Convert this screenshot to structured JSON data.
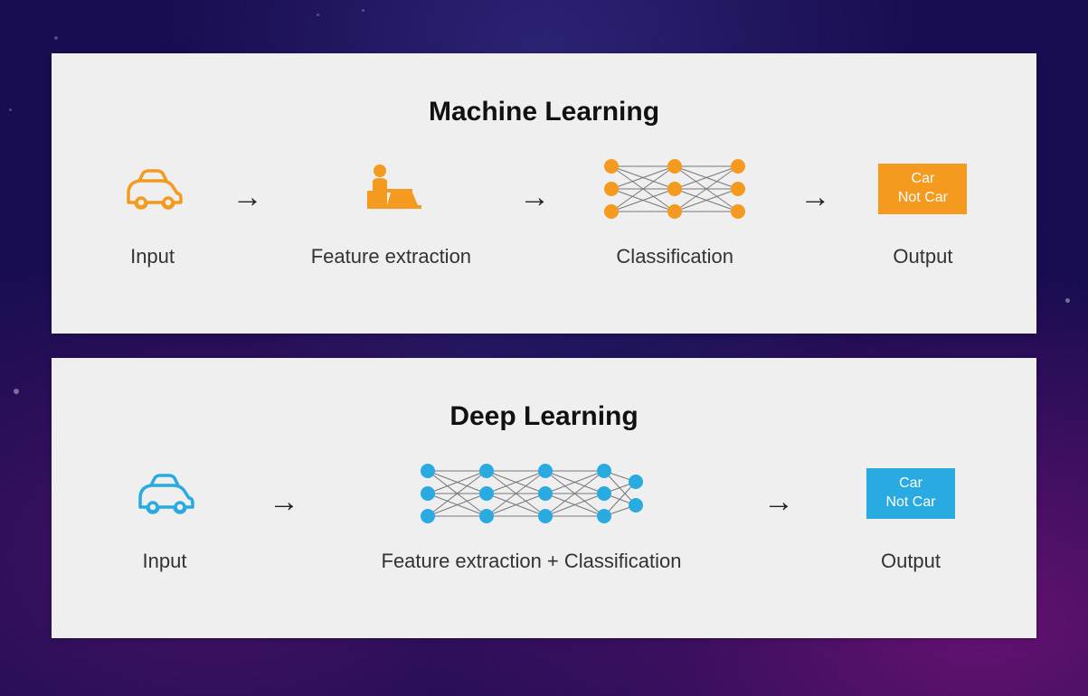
{
  "ml": {
    "title": "Machine Learning",
    "input_label": "Input",
    "feature_label": "Feature extraction",
    "classification_label": "Classification",
    "output_label": "Output",
    "output_line1": "Car",
    "output_line2": "Not Car",
    "accent_color": "#f39a1f"
  },
  "dl": {
    "title": "Deep Learning",
    "input_label": "Input",
    "combined_label": "Feature extraction + Classification",
    "output_label": "Output",
    "output_line1": "Car",
    "output_line2": "Not Car",
    "accent_color": "#29abe2"
  }
}
